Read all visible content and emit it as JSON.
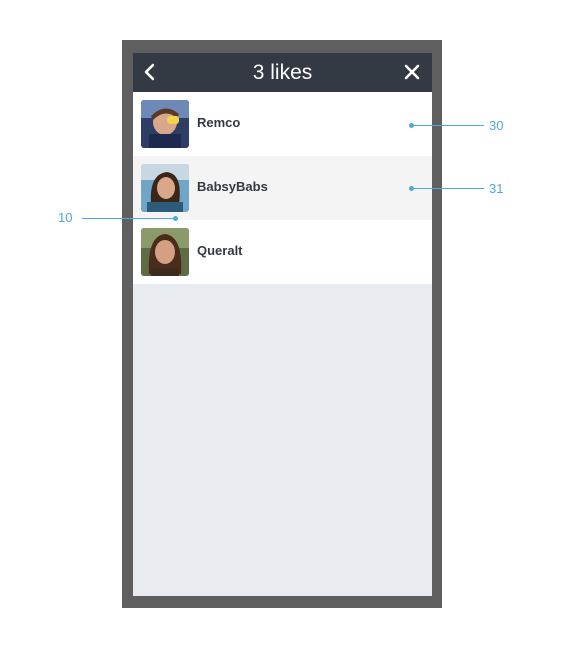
{
  "header": {
    "title": "3 likes",
    "back_icon": "chevron-left-icon",
    "close_icon": "close-icon"
  },
  "likes": [
    {
      "name": "Remco"
    },
    {
      "name": "BabsyBabs"
    },
    {
      "name": "Queralt"
    }
  ],
  "annotations": {
    "remco_row": "30",
    "babsybabs_row": "31",
    "row_gap": "10"
  },
  "colors": {
    "header_bg": "#333a44",
    "frame": "#5f5f5f",
    "screen_bg": "#e8ecf0",
    "callout": "#4fa8d8"
  }
}
